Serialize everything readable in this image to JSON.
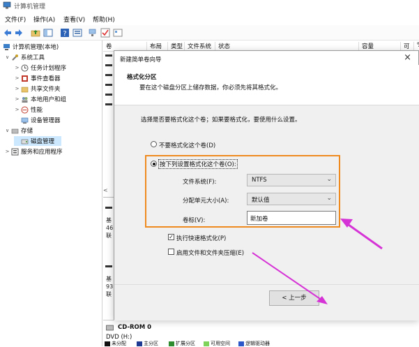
{
  "window": {
    "title": "计算机管理"
  },
  "menu": [
    "文件(F)",
    "操作(A)",
    "查看(V)",
    "帮助(H)"
  ],
  "tree": [
    {
      "label": "计算机管理(本地)",
      "level": 0,
      "expander": "",
      "icon": "computer-icon"
    },
    {
      "label": "系统工具",
      "level": 1,
      "expander": "∨",
      "icon": "tools-icon"
    },
    {
      "label": "任务计划程序",
      "level": 2,
      "expander": ">",
      "icon": "clock-icon"
    },
    {
      "label": "事件查看器",
      "level": 2,
      "expander": ">",
      "icon": "event-viewer-icon"
    },
    {
      "label": "共享文件夹",
      "level": 2,
      "expander": ">",
      "icon": "shared-folder-icon"
    },
    {
      "label": "本地用户和组",
      "level": 2,
      "expander": ">",
      "icon": "users-icon"
    },
    {
      "label": "性能",
      "level": 2,
      "expander": ">",
      "icon": "performance-icon"
    },
    {
      "label": "设备管理器",
      "level": 2,
      "expander": "",
      "icon": "device-manager-icon"
    },
    {
      "label": "存储",
      "level": 1,
      "expander": "∨",
      "icon": "storage-icon"
    },
    {
      "label": "磁盘管理",
      "level": 2,
      "expander": "",
      "icon": "disk-management-icon",
      "selected": true
    },
    {
      "label": "服务和应用程序",
      "level": 1,
      "expander": ">",
      "icon": "services-icon"
    }
  ],
  "columns": [
    "卷",
    "布局",
    "类型",
    "文件系统",
    "状态",
    "容量",
    "可",
    "%"
  ],
  "disks": {
    "disk1": [
      "基",
      "46",
      "联"
    ],
    "disk2": [
      "基",
      "93",
      "联"
    ],
    "cdrom_name": "CD-ROM 0",
    "cdrom_type": "DVD (H:)"
  },
  "legend": [
    {
      "label": "未分配",
      "color": "#111111"
    },
    {
      "label": "主分区",
      "color": "#1f3a93"
    },
    {
      "label": "扩展分区",
      "color": "#2e8b2e"
    },
    {
      "label": "可用空间",
      "color": "#7fd35b"
    },
    {
      "label": "逻辑驱动器",
      "color": "#2b57c9"
    }
  ],
  "dialog": {
    "title": "新建简单卷向导",
    "heading": "格式化分区",
    "subheading": "要在这个磁盘分区上储存数据，你必须先将其格式化。",
    "prompt": "选择是否要格式化这个卷；如果要格式化，要使用什么设置。",
    "radio_no_format": "不要格式化这个卷(D)",
    "radio_format": "按下列设置格式化这个卷(O):",
    "fs_label": "文件系统(F):",
    "fs_value": "NTFS",
    "alloc_label": "分配单元大小(A):",
    "alloc_value": "默认值",
    "vol_label": "卷标(V):",
    "vol_value": "新加卷",
    "quick_format": "执行快速格式化(P)",
    "compression": "启用文件和文件夹压缩(E)",
    "back_button": "< 上一步"
  },
  "colors": {
    "highlight_box": "#ef8a1e",
    "arrow": "#d633d6"
  }
}
